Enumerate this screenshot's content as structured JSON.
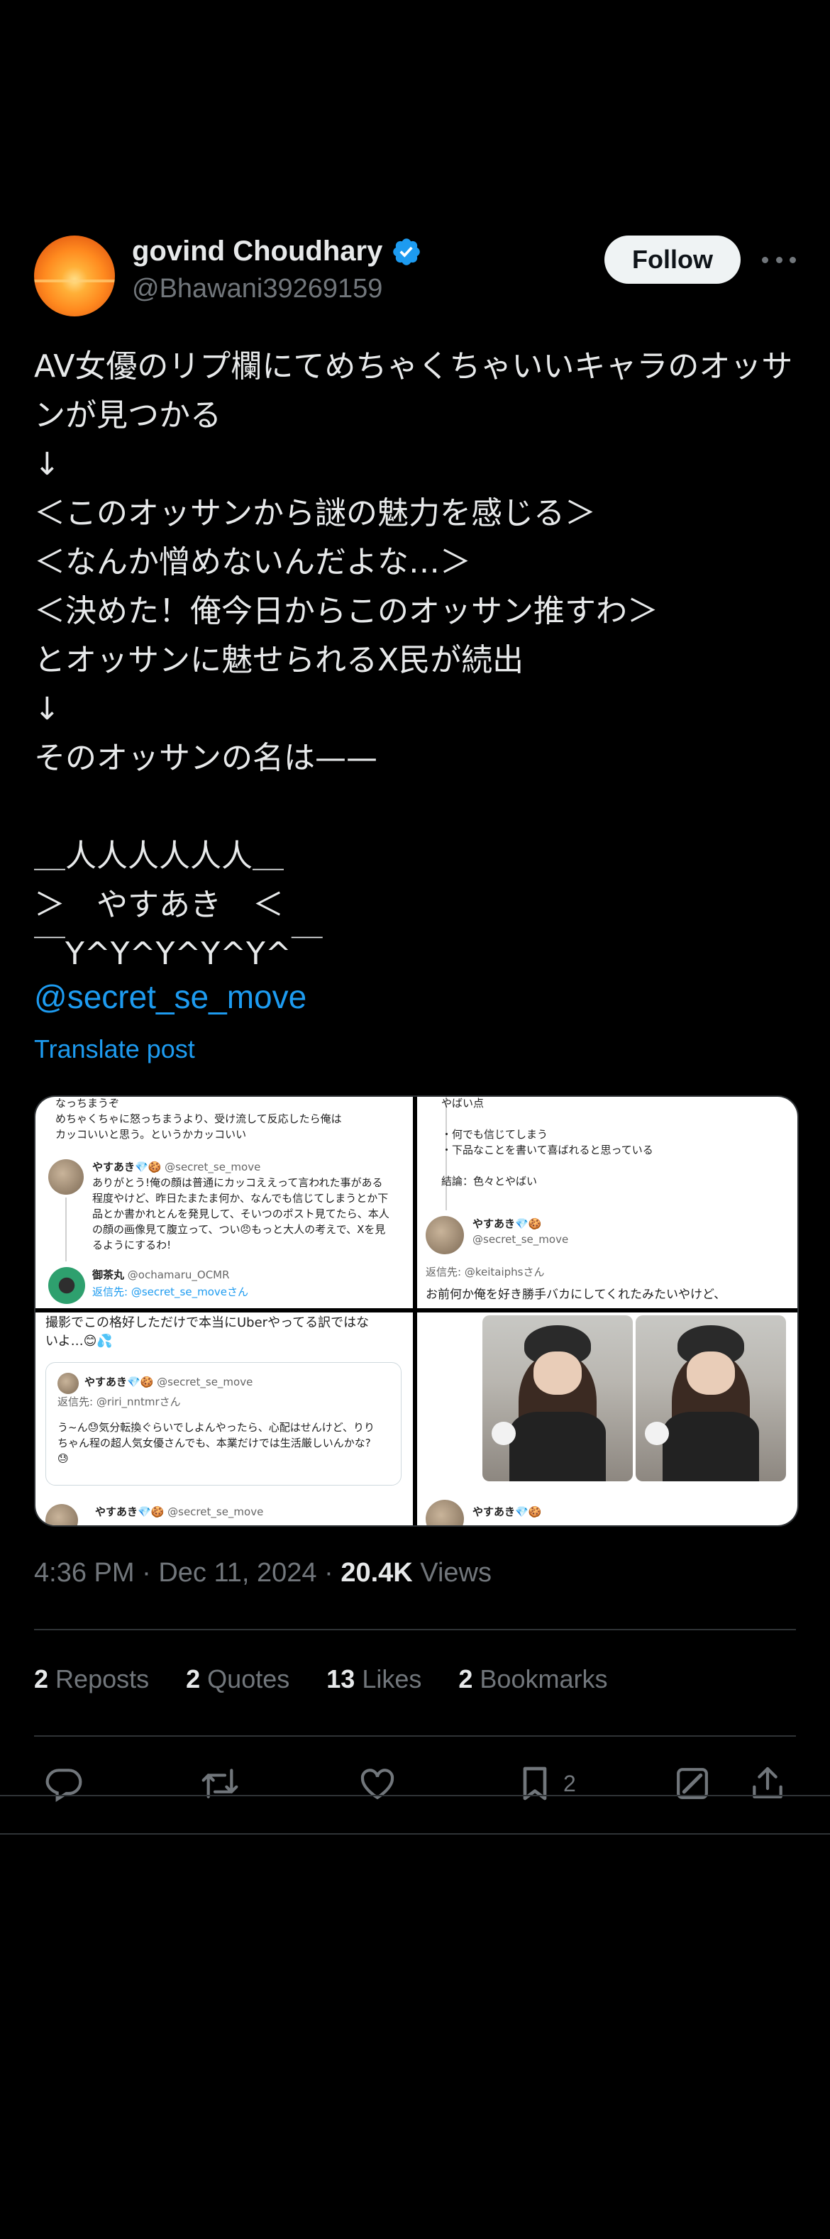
{
  "top_bar": {
    "close_icon": "x-close-icon"
  },
  "author": {
    "name": "govind Choudhary",
    "handle": "@Bhawani39269159",
    "verified_icon": "verified-badge-icon",
    "verified_color": "#1d9bf0",
    "follow_label": "Follow"
  },
  "post": {
    "text": "AV女優のリプ欄にてめちゃくちゃいいキャラのオッサンが見つかる\n↓\n＜このオッサンから謎の魅力を感じる＞\n＜なんか憎めないんだよな…＞\n＜決めた！俺今日からこのオッサン推すわ＞\nとオッサンに魅せられるX民が続出\n↓\nそのオッサンの名は——\n\n＿人人人人人人＿\n＞　やすあき　＜\n￣Y^Y^Y^Y^Y^￣",
    "mention": "@secret_se_move",
    "translate_label": "Translate post"
  },
  "media": {
    "cell1": {
      "top_lines": [
        "なっちまうぞ",
        "めちゃくちゃに怒っちまうより、受け流して反応したら俺は",
        "カッコいいと思う。というかカッコいい"
      ],
      "reply_name": "やすあき💎🍪",
      "reply_handle": "@secret_se_move",
      "reply_lines": [
        "ありがとう!俺の顔は普通にカッコええって言われた事がある",
        "程度やけど、昨日たまたま何か、なんでも信じてしまうとか下",
        "品とか書かれとんを発見して、そいつのポスト見てたら、本人",
        "の顔の画像見て腹立って、つい😠もっと大人の考えで、Xを見",
        "るようにするわ!"
      ],
      "next_name": "御茶丸",
      "next_handle": "@ochamaru_OCMR",
      "next_reply_to": "返信先: @secret_se_moveさん"
    },
    "cell2": {
      "top_lines": [
        "やばい点",
        "",
        "・何でも信じてしまう",
        "・下品なことを書いて喜ばれると思っている",
        "",
        "結論：色々とやばい"
      ],
      "reply_name": "やすあき💎🍪",
      "reply_handle": "@secret_se_move",
      "reply_to": "返信先: @keitaiphsさん",
      "bottom_line": "お前何か俺を好き勝手バカにしてくれたみたいやけど、"
    },
    "cell3": {
      "top_lines": [
        "撮影でこの格好しただけで本当にUberやってる訳ではな",
        "いよ…😊💦"
      ],
      "quote_name": "やすあき💎🍪",
      "quote_handle": "@secret_se_move",
      "quote_reply_to": "返信先: @riri_nntmrさん",
      "quote_lines": [
        "う~ん😓気分転換ぐらいでしよんやったら、心配はせんけど、りり",
        "ちゃん程の超人気女優さんでも、本業だけでは生活厳しいんかな?",
        "😓"
      ],
      "bottom_name": "やすあき💎🍪",
      "bottom_handle": "@secret_se_move"
    },
    "cell4": {
      "bottom_name": "やすあき💎🍪"
    }
  },
  "meta": {
    "time": "4:36 PM",
    "date": "Dec 11, 2024",
    "views_count": "20.4K",
    "views_label": "Views"
  },
  "stats": {
    "reposts_count": "2",
    "reposts_label": "Reposts",
    "quotes_count": "2",
    "quotes_label": "Quotes",
    "likes_count": "13",
    "likes_label": "Likes",
    "bookmarks_count": "2",
    "bookmarks_label": "Bookmarks"
  },
  "actions": {
    "reply_icon": "reply-icon",
    "repost_icon": "repost-icon",
    "like_icon": "heart-icon",
    "bookmark_icon": "bookmark-icon",
    "bookmark_count": "2",
    "grok_icon": "grok-icon",
    "share_icon": "share-icon"
  }
}
